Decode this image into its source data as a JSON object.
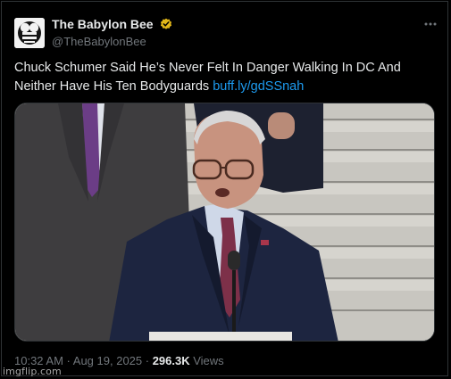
{
  "post": {
    "author": {
      "display_name": "The Babylon Bee",
      "handle": "@TheBabylonBee",
      "verified_badge_icon": "gold-checkmark-icon",
      "avatar_icon": "babylon-bee-logo-icon"
    },
    "more_icon": "ellipsis-icon",
    "text": "Chuck Schumer Said He’s Never Felt In Danger Walking In DC And Neither Have His Ten Bodyguards ",
    "link_text": "buff.ly/gdSSnah",
    "media": {
      "kind": "photo"
    },
    "meta": {
      "time": "10:32 AM",
      "separator1": " · ",
      "date": "Aug 19, 2025",
      "separator2": " · ",
      "views_count": "296.3K",
      "views_label": " Views"
    }
  },
  "colors": {
    "background": "#000000",
    "text": "#e7e9ea",
    "muted": "#71767b",
    "link": "#1d9bf0",
    "verified": "#e2b719"
  },
  "watermark": "imgflip.com"
}
